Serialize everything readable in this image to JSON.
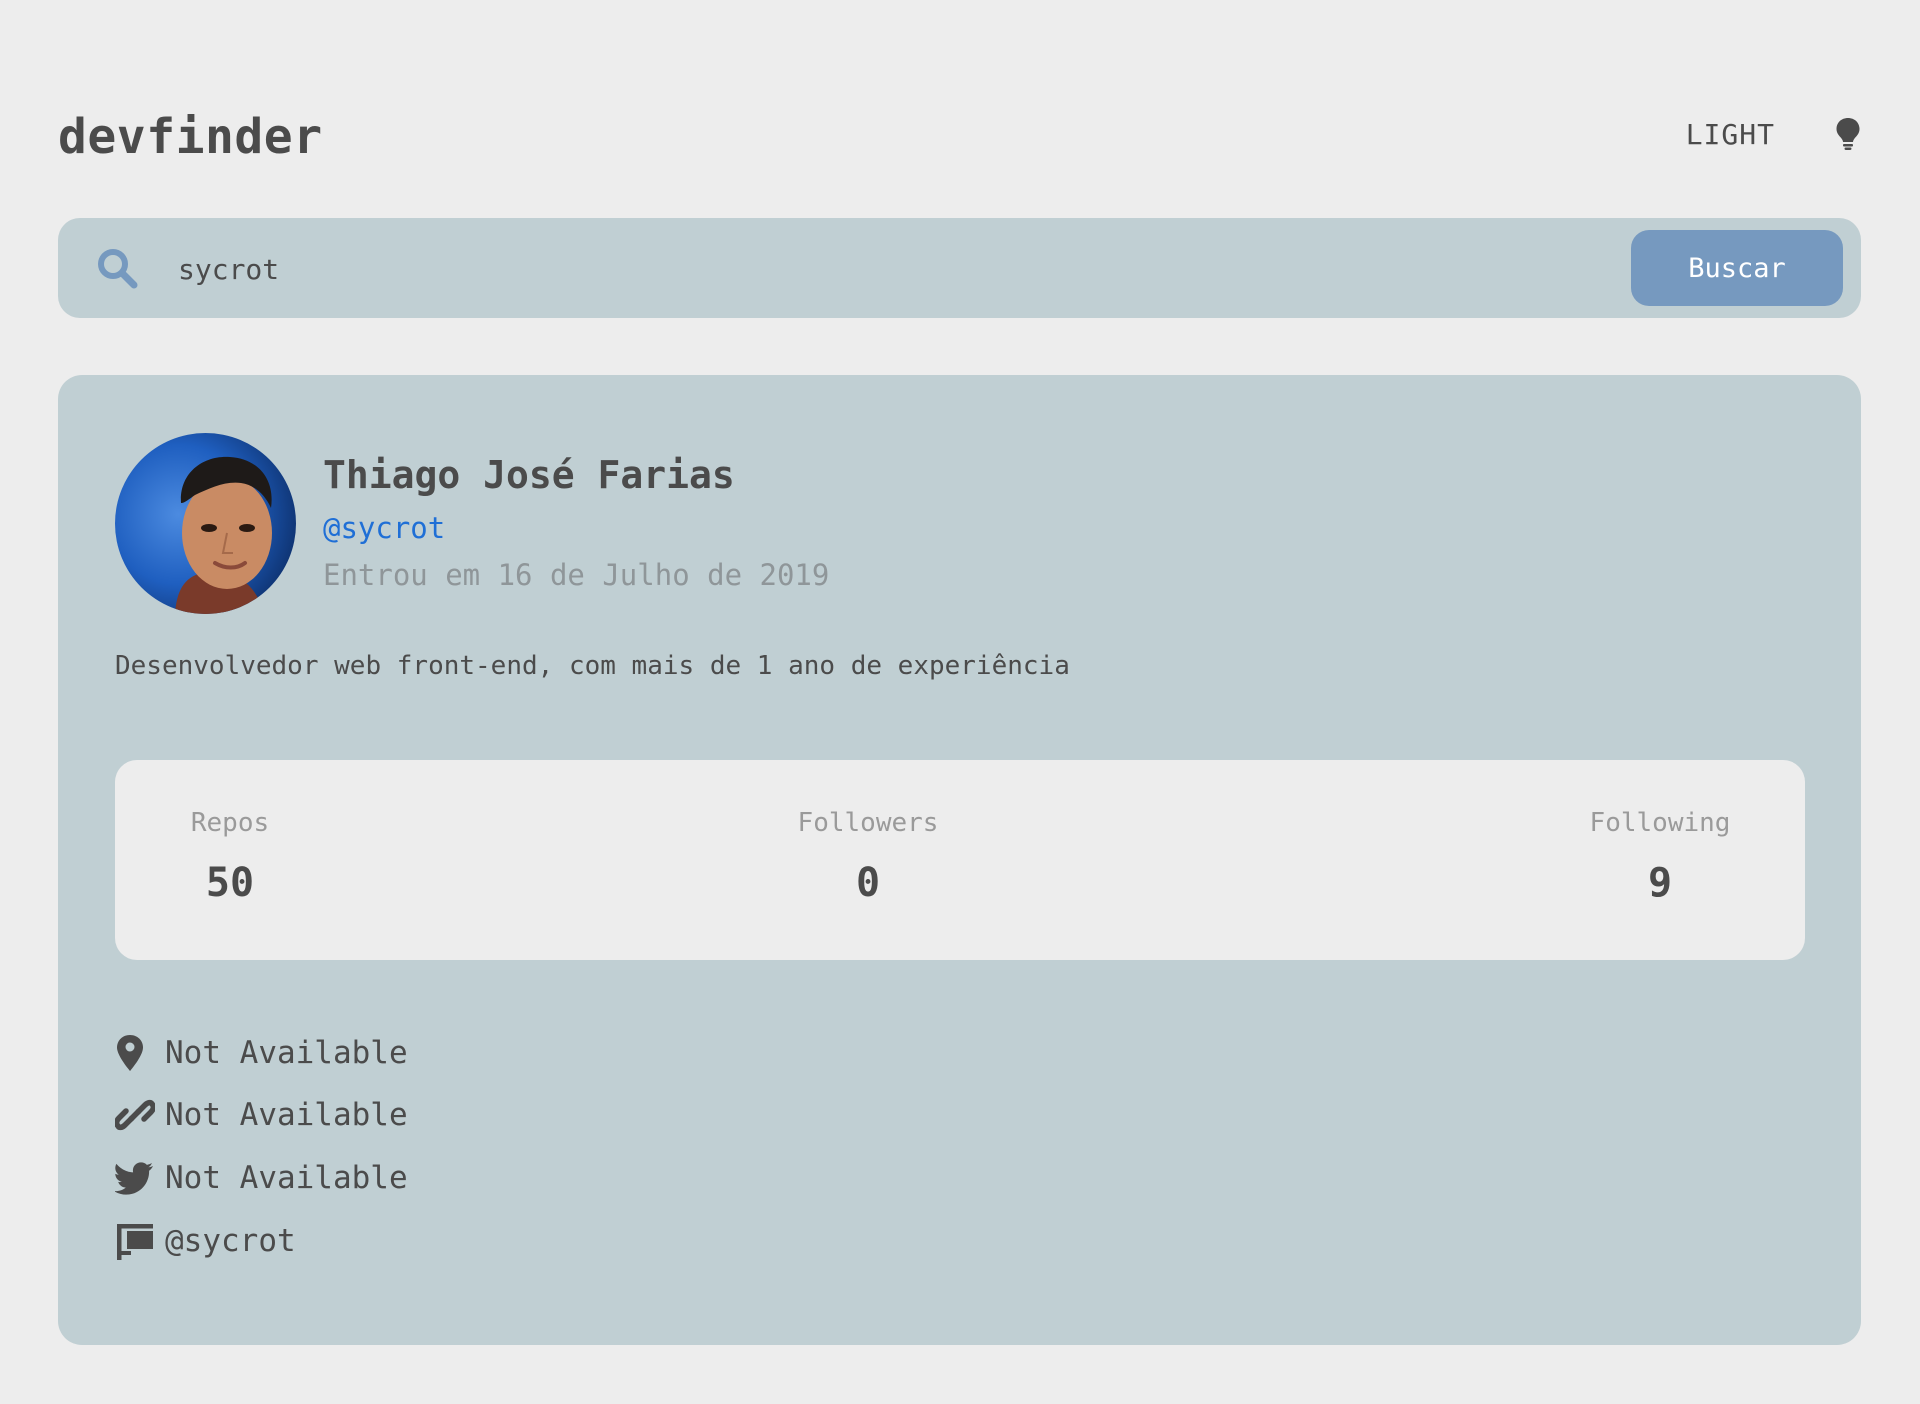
{
  "header": {
    "logo": "devfinder",
    "theme_label": "LIGHT",
    "theme_icon": "lightbulb-icon"
  },
  "search": {
    "value": "sycrot",
    "placeholder": "",
    "button_label": "Buscar",
    "icon": "search-icon"
  },
  "profile": {
    "name": "Thiago José Farias",
    "login": "@sycrot",
    "joined": "Entrou em 16 de Julho de 2019",
    "bio": "Desenvolvedor web front-end, com mais de 1 ano de experiência",
    "avatar": "avatar-image"
  },
  "stats": {
    "repos_label": "Repos",
    "repos_value": "50",
    "followers_label": "Followers",
    "followers_value": "0",
    "following_label": "Following",
    "following_value": "9"
  },
  "links": {
    "location": "Not Available",
    "blog": "Not Available",
    "twitter": "Not Available",
    "company": "@sycrot"
  },
  "colors": {
    "page_background": "#ededed",
    "card_background": "#c0cfd3",
    "button_background": "#7699bf",
    "text": "#4b4b4b",
    "link": "#1f6fd6",
    "muted": "#8f9699"
  }
}
